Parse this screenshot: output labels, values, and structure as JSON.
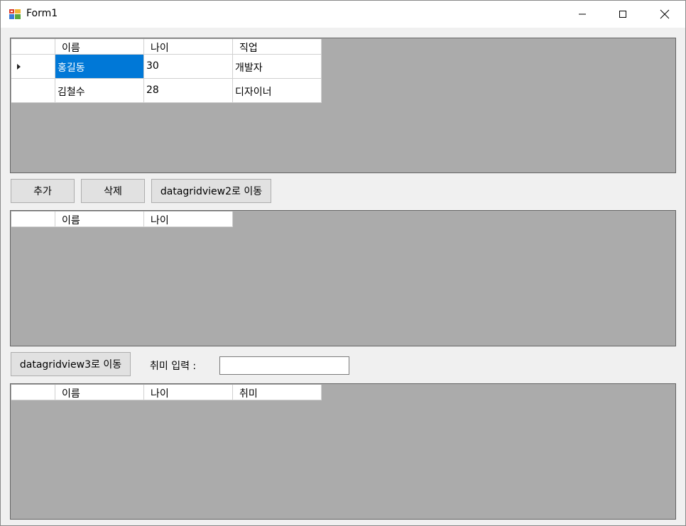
{
  "window": {
    "title": "Form1"
  },
  "grid1": {
    "headers": [
      "이름",
      "나이",
      "직업"
    ],
    "rows": [
      [
        "홍길동",
        "30",
        "개발자"
      ],
      [
        "김철수",
        "28",
        "디자이너"
      ]
    ]
  },
  "buttons": {
    "add": "추가",
    "delete": "삭제",
    "move_to_grid2": "datagridview2로 이동",
    "move_to_grid3": "datagridview3로 이동"
  },
  "grid2": {
    "headers": [
      "이름",
      "나이"
    ]
  },
  "hobby": {
    "label": "취미 입력 :",
    "value": ""
  },
  "grid3": {
    "headers": [
      "이름",
      "나이",
      "취미"
    ]
  }
}
